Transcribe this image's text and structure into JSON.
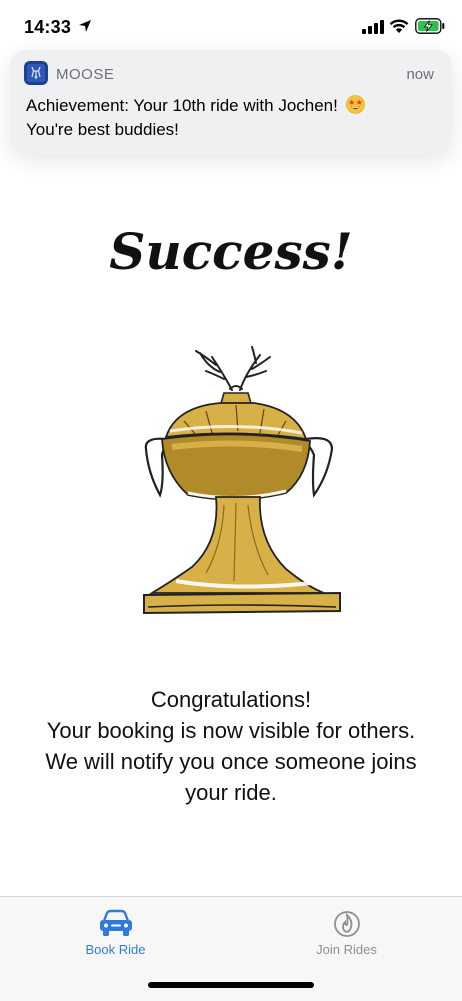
{
  "status_bar": {
    "time": "14:33"
  },
  "notification": {
    "app_name": "MOOSE",
    "time": "now",
    "message": "Achievement: Your 10th ride with Jochen!",
    "message_line2": "You're best buddies!"
  },
  "main": {
    "title": "Success!",
    "message_lines": [
      "Congratulations!",
      "Your booking is now visible for others.",
      "We will notify you once someone joins",
      "your ride."
    ]
  },
  "tab_bar": {
    "tabs": [
      {
        "label": "Book Ride",
        "icon": "car-icon",
        "active": true
      },
      {
        "label": "Join Rides",
        "icon": "flame-icon",
        "active": false
      }
    ]
  },
  "colors": {
    "accent": "#2f7bdc",
    "inactive": "#8e8e93",
    "trophy_gold": "#d7b148",
    "trophy_dark": "#b18a2a",
    "app_icon": "#1f3f8f"
  }
}
